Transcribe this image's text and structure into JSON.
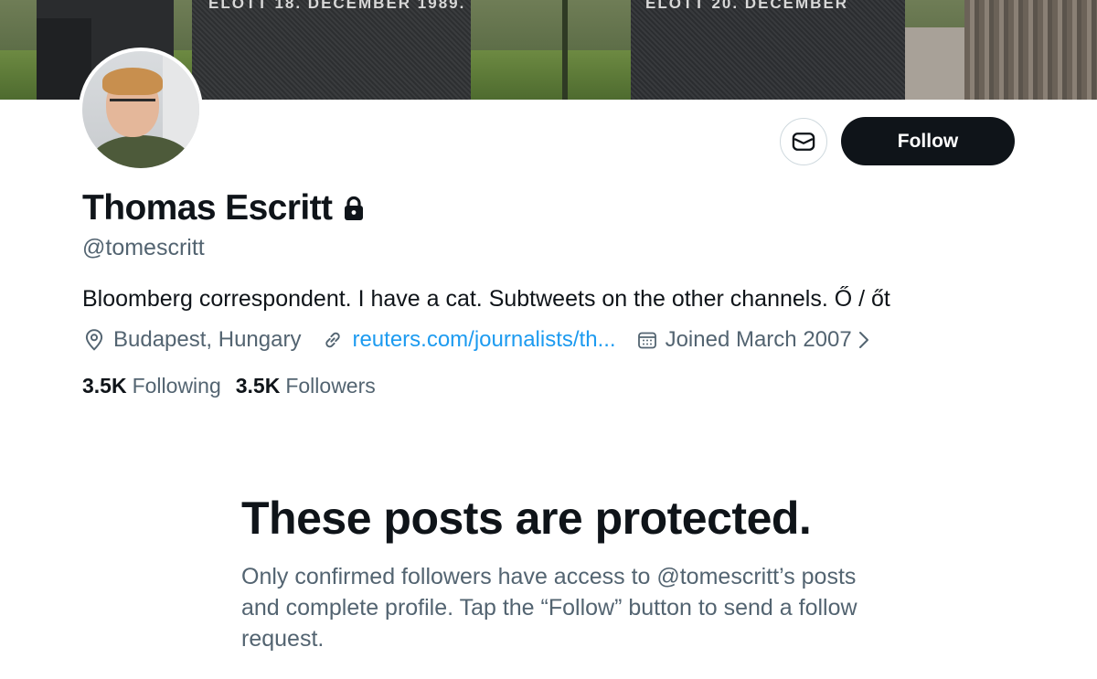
{
  "banner": {
    "engraving_left": "ELŐTT 18. DECEMBER 1989.",
    "engraving_right": "ELŐTT 20. DECEMBER"
  },
  "profile": {
    "name": "Thomas Escritt",
    "handle": "@tomescritt",
    "bio": "Bloomberg correspondent. I have a cat. Subtweets on the other channels. Ő / őt",
    "location": "Budapest, Hungary",
    "website": "reuters.com/journalists/th...",
    "joined": "Joined March 2007",
    "following_count": "3.5K",
    "following_label": "Following",
    "followers_count": "3.5K",
    "followers_label": "Followers"
  },
  "actions": {
    "follow_label": "Follow",
    "message_icon": "envelope-icon"
  },
  "icons": {
    "lock": "lock-icon",
    "location": "location-pin-icon",
    "link": "link-icon",
    "calendar": "calendar-icon",
    "chevron": "chevron-right-icon"
  },
  "protected": {
    "title": "These posts are protected.",
    "body": "Only confirmed followers have access to @tomescritt’s posts and complete profile. Tap the “Follow” button to send a follow request."
  },
  "colors": {
    "primary_text": "#0f1419",
    "secondary_text": "#536471",
    "link": "#1d9bf0",
    "follow_bg": "#0f1419",
    "border": "#cfd9de"
  }
}
